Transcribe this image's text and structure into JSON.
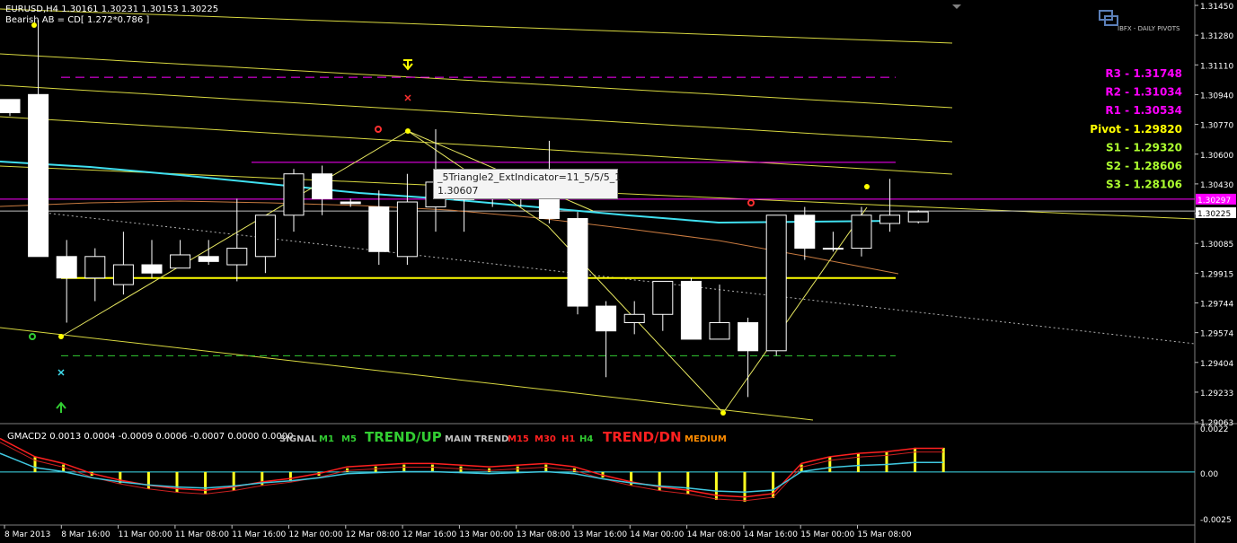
{
  "header": {
    "symbol_line": "EURUSD,H4  1.30161 1.30231 1.30153 1.30225",
    "pattern_line": "Bearish AB = CD[ 1.272*0.786 ]"
  },
  "tooltip": {
    "line1": "_5Triangle2_ExtIndicator=11_5/5/5_1",
    "line2": "1.30607"
  },
  "pivot_panel": {
    "brand": "IBFX - DAILY PIVOTS",
    "levels": [
      {
        "label": "R3 - 1.31748",
        "value": 1.31748,
        "color": "#ff00ff"
      },
      {
        "label": "R2 - 1.31034",
        "value": 1.31034,
        "color": "#ff00ff"
      },
      {
        "label": "R1 - 1.30534",
        "value": 1.30534,
        "color": "#ff00ff"
      },
      {
        "label": "Pivot - 1.29820",
        "value": 1.2982,
        "color": "#ffff00"
      },
      {
        "label": "S1 - 1.29320",
        "value": 1.2932,
        "color": "#adff2f"
      },
      {
        "label": "S2 - 1.28606",
        "value": 1.28606,
        "color": "#adff2f"
      },
      {
        "label": "S3 - 1.28106",
        "value": 1.28106,
        "color": "#adff2f"
      }
    ]
  },
  "chart_data": [
    {
      "type": "candlestick",
      "title": "EURUSD,H4",
      "ylim": [
        1.2895,
        1.3148
      ],
      "yticks": [
        "1.31450",
        "1.31280",
        "1.31110",
        "1.30940",
        "1.30770",
        "1.30600",
        "1.30430",
        "1.30255",
        "1.30085",
        "1.29915",
        "1.29744",
        "1.29574",
        "1.29404",
        "1.29233",
        "1.29063"
      ],
      "current_price_label": "1.30225",
      "marked_price_label": "1.30297",
      "candles": [
        {
          "o": 1.309,
          "h": 1.309,
          "l": 1.308,
          "c": 1.3082
        },
        {
          "o": 1.3093,
          "h": 1.3138,
          "l": 1.2995,
          "c": 1.2995
        },
        {
          "o": 1.2995,
          "h": 1.3005,
          "l": 1.2955,
          "c": 1.2982
        },
        {
          "o": 1.2982,
          "h": 1.3,
          "l": 1.2968,
          "c": 1.2995
        },
        {
          "o": 1.2978,
          "h": 1.301,
          "l": 1.2972,
          "c": 1.299
        },
        {
          "o": 1.299,
          "h": 1.3005,
          "l": 1.2982,
          "c": 1.2985
        },
        {
          "o": 1.2988,
          "h": 1.3005,
          "l": 1.2988,
          "c": 1.2996
        },
        {
          "o": 1.2995,
          "h": 1.3005,
          "l": 1.299,
          "c": 1.2992
        },
        {
          "o": 1.299,
          "h": 1.303,
          "l": 1.298,
          "c": 1.3
        },
        {
          "o": 1.2995,
          "h": 1.302,
          "l": 1.2985,
          "c": 1.302
        },
        {
          "o": 1.302,
          "h": 1.3048,
          "l": 1.301,
          "c": 1.3045
        },
        {
          "o": 1.3045,
          "h": 1.305,
          "l": 1.302,
          "c": 1.303
        },
        {
          "o": 1.3028,
          "h": 1.303,
          "l": 1.3025,
          "c": 1.3027
        },
        {
          "o": 1.3025,
          "h": 1.3035,
          "l": 1.299,
          "c": 1.2998
        },
        {
          "o": 1.2995,
          "h": 1.3045,
          "l": 1.299,
          "c": 1.3028
        },
        {
          "o": 1.3025,
          "h": 1.3072,
          "l": 1.301,
          "c": 1.304
        },
        {
          "o": 1.303,
          "h": 1.304,
          "l": 1.301,
          "c": 1.303
        },
        {
          "o": 1.303,
          "h": 1.304,
          "l": 1.3025,
          "c": 1.3033
        },
        {
          "o": 1.3033,
          "h": 1.304,
          "l": 1.3025,
          "c": 1.303
        },
        {
          "o": 1.3035,
          "h": 1.3065,
          "l": 1.3015,
          "c": 1.3018
        },
        {
          "o": 1.3018,
          "h": 1.3022,
          "l": 1.296,
          "c": 1.2965
        },
        {
          "o": 1.2965,
          "h": 1.2968,
          "l": 1.2922,
          "c": 1.295
        },
        {
          "o": 1.2955,
          "h": 1.2968,
          "l": 1.2948,
          "c": 1.296
        },
        {
          "o": 1.296,
          "h": 1.298,
          "l": 1.295,
          "c": 1.298
        },
        {
          "o": 1.298,
          "h": 1.2982,
          "l": 1.2945,
          "c": 1.2945
        },
        {
          "o": 1.2945,
          "h": 1.2978,
          "l": 1.2945,
          "c": 1.2955
        },
        {
          "o": 1.2955,
          "h": 1.2958,
          "l": 1.291,
          "c": 1.2938
        },
        {
          "o": 1.2938,
          "h": 1.302,
          "l": 1.2935,
          "c": 1.302
        },
        {
          "o": 1.302,
          "h": 1.3025,
          "l": 1.2993,
          "c": 1.3
        },
        {
          "o": 1.3,
          "h": 1.301,
          "l": 1.2998,
          "c": 1.3
        },
        {
          "o": 1.3,
          "h": 1.3025,
          "l": 1.2995,
          "c": 1.302
        },
        {
          "o": 1.3015,
          "h": 1.3042,
          "l": 1.301,
          "c": 1.302
        },
        {
          "o": 1.3016,
          "h": 1.3023,
          "l": 1.3015,
          "c": 1.3022
        }
      ],
      "pivot_lines": [
        1.31748,
        1.31034,
        1.30534,
        1.2982,
        1.2932,
        1.28606,
        1.28106
      ],
      "xticks": [
        "8 Mar 2013",
        "8 Mar 16:00",
        "11 Mar 00:00",
        "11 Mar 08:00",
        "11 Mar 16:00",
        "12 Mar 00:00",
        "12 Mar 08:00",
        "12 Mar 16:00",
        "13 Mar 00:00",
        "13 Mar 08:00",
        "13 Mar 16:00",
        "14 Mar 00:00",
        "14 Mar 08:00",
        "14 Mar 16:00",
        "15 Mar 00:00",
        "15 Mar 08:00"
      ]
    },
    {
      "type": "bar+line",
      "title": "GMACD2 0.0013 0.0004 -0.0009 0.0006 -0.0007 0.0000 0.0000",
      "ylim": [
        -0.0028,
        0.0025
      ],
      "yticks": [
        "0.0022",
        "0.00",
        "-0.0025"
      ],
      "histogram": [
        0.0008,
        0.0004,
        -0.0002,
        -0.0006,
        -0.0009,
        -0.0011,
        -0.0012,
        -0.001,
        -0.0007,
        -0.0005,
        -0.0002,
        0.0002,
        0.0003,
        0.0004,
        0.0004,
        0.0003,
        0.0002,
        0.0003,
        0.0004,
        0.0002,
        -0.0003,
        -0.0007,
        -0.001,
        -0.0012,
        -0.0015,
        -0.0016,
        -0.0014,
        0.0004,
        0.0008,
        0.001,
        0.0011,
        0.0013,
        0.0013
      ],
      "signal_labels": [
        {
          "text": "SIGNAL",
          "color": "#c0c0c0"
        },
        {
          "text": "M1",
          "color": "#32cd32"
        },
        {
          "text": "M5",
          "color": "#32cd32"
        },
        {
          "text": "TREND/UP",
          "color": "#32cd32"
        },
        {
          "text": "MAIN TREND",
          "color": "#c0c0c0"
        },
        {
          "text": "M15",
          "color": "#ff2020"
        },
        {
          "text": "M30",
          "color": "#ff2020"
        },
        {
          "text": "H1",
          "color": "#ff2020"
        },
        {
          "text": "H4",
          "color": "#32cd32"
        },
        {
          "text": "TREND/DN",
          "color": "#ff2020"
        },
        {
          "text": "MEDIUM",
          "color": "#ff8c00"
        }
      ]
    }
  ]
}
